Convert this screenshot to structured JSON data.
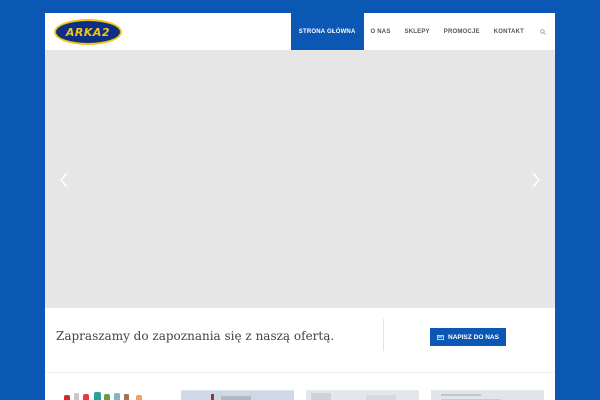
{
  "logo": {
    "text": "ARKA2"
  },
  "nav": {
    "items": [
      {
        "label": "STRONA GŁÓWNA",
        "active": true
      },
      {
        "label": "O NAS"
      },
      {
        "label": "SKLEPY"
      },
      {
        "label": "PROMOCJE"
      },
      {
        "label": "KONTAKT"
      }
    ],
    "search_icon": "search-icon"
  },
  "slider": {
    "prev_icon": "chevron-left-icon",
    "next_icon": "chevron-right-icon"
  },
  "cta": {
    "text": "Zapraszamy do zapoznania się z naszą ofertą.",
    "button_label": "NAPISZ DO NAS",
    "button_icon": "envelope-icon"
  },
  "colors": {
    "brand": "#0b57b4",
    "logo_yellow": "#f2c614",
    "slider_bg": "#e6e6e6"
  }
}
